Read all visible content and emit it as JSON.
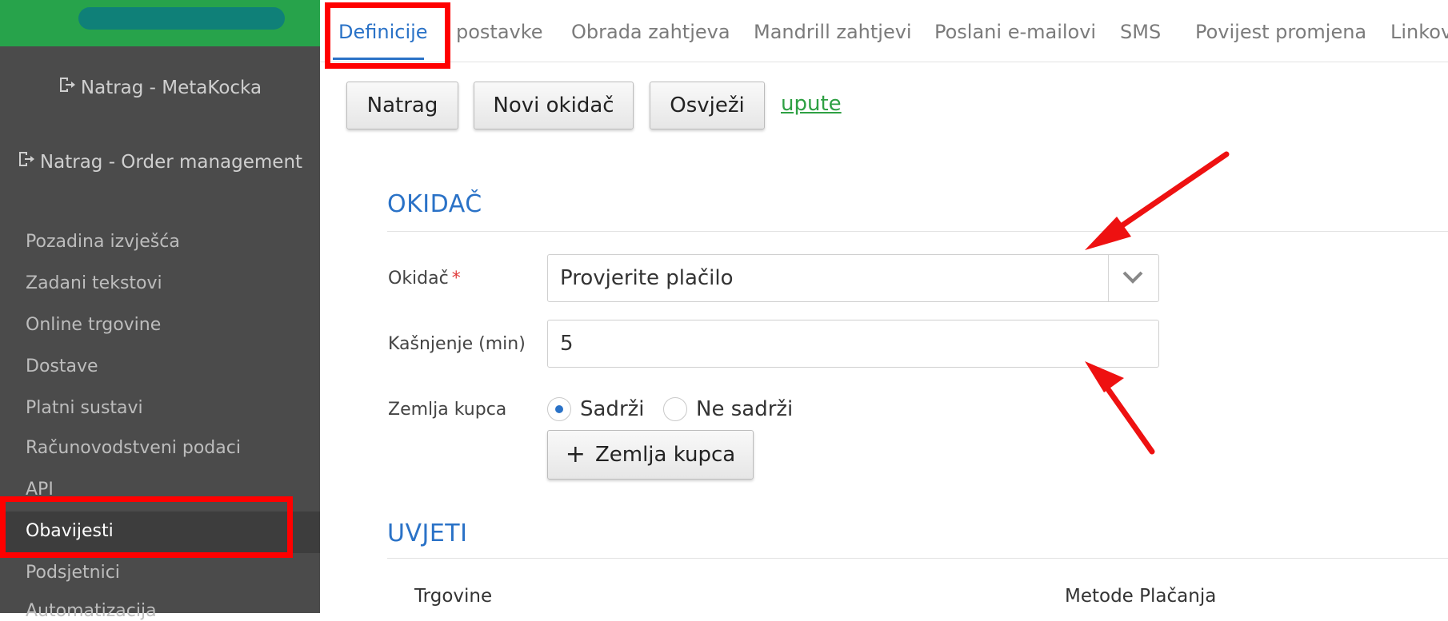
{
  "sidebar": {
    "back_links": [
      {
        "label": "Natrag - MetaKocka",
        "icon": "logout-icon"
      },
      {
        "label": "Natrag - Order management",
        "icon": "logout-icon"
      }
    ],
    "items": [
      {
        "label": "Pozadina izvješća"
      },
      {
        "label": "Zadani tekstovi"
      },
      {
        "label": "Online trgovine"
      },
      {
        "label": "Dostave"
      },
      {
        "label": "Platni sustavi"
      },
      {
        "label": "Računovodstveni podaci"
      },
      {
        "label": "API"
      },
      {
        "label": "Obavijesti",
        "active": true
      },
      {
        "label": "Podsjetnici"
      },
      {
        "label": "Automatizacija"
      }
    ]
  },
  "tabs": [
    {
      "label": "Definicije",
      "active": true
    },
    {
      "label": "postavke"
    },
    {
      "label": "Obrada zahtjeva"
    },
    {
      "label": "Mandrill zahtjevi"
    },
    {
      "label": "Poslani e-mailovi"
    },
    {
      "label": "SMS"
    },
    {
      "label": "Povijest promjena"
    },
    {
      "label": "Linkovi"
    }
  ],
  "toolbar": {
    "back_label": "Natrag",
    "new_trigger_label": "Novi okidač",
    "refresh_label": "Osvježi",
    "help_link": "upute"
  },
  "trigger_section": {
    "title": "OKIDAČ",
    "trigger_label": "Okidač",
    "required_mark": "*",
    "trigger_value": "Provjerite plačilo",
    "delay_label": "Kašnjenje (min)",
    "delay_value": "5",
    "country_label": "Zemlja kupca",
    "radio_contains": "Sadrži",
    "radio_not_contains": "Ne sadrži",
    "selected_radio": "Sadrži",
    "add_country_label": "Zemlja kupca"
  },
  "conditions_section": {
    "title": "UVJETI",
    "columns": [
      "Trgovine",
      "Metode Plačanja"
    ]
  },
  "colors": {
    "brand": "#27a34b",
    "sidebar_bg": "#4b4b4b",
    "accent": "#2a72c7",
    "link": "#2ea043",
    "highlight": "#ff0000"
  }
}
